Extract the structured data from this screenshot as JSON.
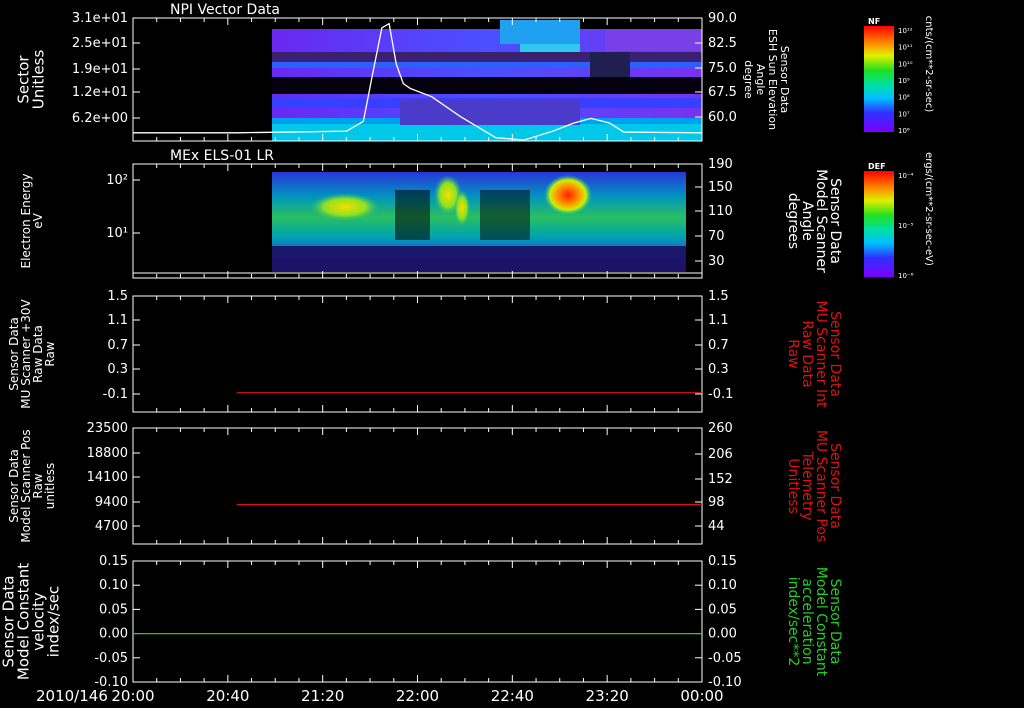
{
  "time_axis": {
    "date_label": "2010/146",
    "ticks": [
      "20:00",
      "20:40",
      "21:20",
      "22:00",
      "22:40",
      "23:20",
      "00:00"
    ],
    "range_hours": [
      20,
      24
    ]
  },
  "colorbars": [
    {
      "title": "NF",
      "units": "cnts/(cm**2-sr-sec)",
      "ticks": [
        "10¹²",
        "10¹¹",
        "10¹⁰",
        "10⁹",
        "10⁸",
        "10⁷",
        "10⁶"
      ]
    },
    {
      "title": "DEF",
      "units": "ergs/(cm**2-sr-sec-eV)",
      "ticks": [
        "10⁻⁴",
        "10⁻⁵",
        "10⁻⁶"
      ]
    }
  ],
  "chart_data": [
    {
      "type": "heatmap",
      "title": "NPI Vector Data",
      "ylabel_lines": [
        "Sector",
        "Unitless"
      ],
      "yticks": [
        "3.1e+01",
        "2.5e+01",
        "1.9e+01",
        "1.2e+01",
        "6.2e+00"
      ],
      "ylabel_right_lines": [
        "Sensor Data",
        "ESH Sun Elevation",
        "Angle",
        "degree"
      ],
      "yticks_right": [
        "90.0",
        "82.5",
        "75.0",
        "67.5",
        "60.0"
      ],
      "ylim_right": [
        52.5,
        90
      ],
      "data_start_hour": 20.73,
      "overlay_line": {
        "color": "#ffffff",
        "x": [
          20.0,
          20.73,
          21.5,
          21.62,
          21.68,
          21.75,
          21.8,
          21.85,
          21.9,
          21.95,
          22.1,
          22.3,
          22.55,
          22.75,
          22.95,
          23.1,
          23.22,
          23.35,
          23.45,
          24.0
        ],
        "y": [
          55.0,
          55.0,
          55.5,
          58.5,
          72.0,
          87.0,
          88.3,
          76.0,
          70.0,
          68.5,
          66.0,
          60.0,
          53.5,
          52.8,
          55.5,
          58.0,
          59.4,
          58.0,
          55.2,
          55.0
        ]
      }
    },
    {
      "type": "heatmap",
      "title": "MEx ELS-01 LR",
      "ylabel_lines": [
        "Electron Energy",
        "eV"
      ],
      "yticks": [
        "10²",
        "10¹"
      ],
      "ylabel_right_lines": [
        "Sensor Data",
        "Model Scanner",
        "Angle",
        "degrees"
      ],
      "yticks_right": [
        "190",
        "150",
        "110",
        "70",
        "30"
      ],
      "data_range_hours": [
        20.73,
        23.93
      ]
    },
    {
      "type": "line",
      "ylabel_lines": [
        "Sensor Data",
        "MU Scanner +30V",
        "Raw Data",
        "Raw"
      ],
      "yticks": [
        "1.5",
        "1.1",
        "0.7",
        "0.3",
        "-0.1"
      ],
      "ylim": [
        -0.3,
        1.5
      ],
      "ylabel_right_lines": [
        "Sensor Data",
        "MU Scanner Int",
        "Raw Data",
        "Raw"
      ],
      "yticks_right": [
        "1.5",
        "1.1",
        "0.7",
        "0.3",
        "-0.1"
      ],
      "series": [
        {
          "color": "#e01010",
          "x": [
            20.73,
            24.0
          ],
          "y": [
            0.0,
            0.0
          ]
        }
      ]
    },
    {
      "type": "line",
      "ylabel_lines": [
        "Sensor Data",
        "Model Scanner Pos",
        "Raw",
        "unitless"
      ],
      "yticks": [
        "23500",
        "18800",
        "14100",
        "9400",
        "4700"
      ],
      "ylim": [
        0,
        23500
      ],
      "ylabel_right_lines": [
        "Sensor Data",
        "MU Scanner Pos",
        "Telemetry",
        "Unitless"
      ],
      "yticks_right": [
        "260",
        "206",
        "152",
        "98",
        "44"
      ],
      "series": [
        {
          "color": "#e01010",
          "x": [
            20.73,
            24.0
          ],
          "y": [
            8000,
            8000
          ]
        }
      ]
    },
    {
      "type": "line",
      "ylabel_lines": [
        "Sensor Data",
        "Model Constant",
        "velocity",
        "index/sec"
      ],
      "yticks": [
        "0.15",
        "0.10",
        "0.05",
        "0.00",
        "-0.05",
        "-0.10"
      ],
      "ylim": [
        -0.1,
        0.15
      ],
      "ylabel_right_lines": [
        "Sensor Data",
        "Model Constant",
        "acceleration",
        "index/sec**2"
      ],
      "yticks_right": [
        "0.15",
        "0.10",
        "0.05",
        "0.00",
        "-0.05",
        "-0.10"
      ],
      "series": [
        {
          "color": "#20d020",
          "x": [
            20.0,
            24.0
          ],
          "y": [
            0.0,
            0.0
          ]
        }
      ]
    }
  ]
}
